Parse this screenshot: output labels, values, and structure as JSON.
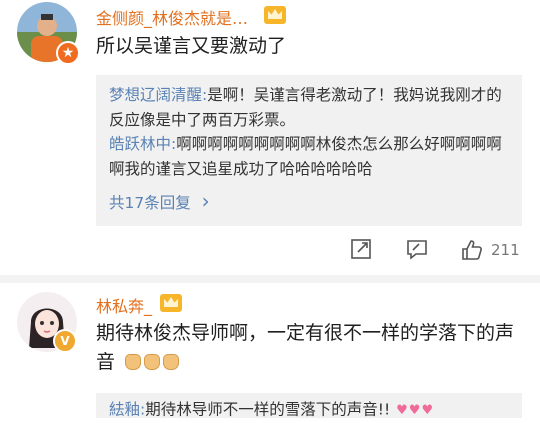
{
  "comment1": {
    "username": "金侧颜_林俊杰就是…",
    "text": "所以吴谨言又要激动了",
    "replies": [
      {
        "name": "梦想辽阔清醒",
        "sep": ":",
        "text": "是啊！吴谨言得老激动了！我妈说我刚才的反应像是中了两百万彩票。"
      },
      {
        "name": "皓跃林中",
        "sep": ":",
        "text": "啊啊啊啊啊啊啊啊啊林俊杰怎么那么好啊啊啊啊啊我的谨言又追星成功了哈哈哈哈哈哈"
      }
    ],
    "more_replies": "共17条回复",
    "more_chevron": "›",
    "like_count": "211"
  },
  "comment2": {
    "username": "林私奔_",
    "text": "期待林俊杰导师啊，一定有很不一样的学落下的声音",
    "reply": {
      "name": "紶釉",
      "sep": ":",
      "text": "期待林导师不一样的雪落下的声音!!"
    }
  },
  "icons": {
    "ellipsis": "…",
    "crown": "crown-badge-icon",
    "vip": "vip-badge-icon",
    "share": "share-icon",
    "comment": "comment-icon",
    "like": "thumbs-up-icon",
    "clap": "clapping-hands-emoji",
    "heart": "heart-emoji"
  },
  "colors": {
    "username": "#e2701f",
    "reply_name": "#5a82b4",
    "reply_bg": "#f1f1f1",
    "vip_gold": "#f0a830",
    "vip_orange": "#f06a1f"
  }
}
